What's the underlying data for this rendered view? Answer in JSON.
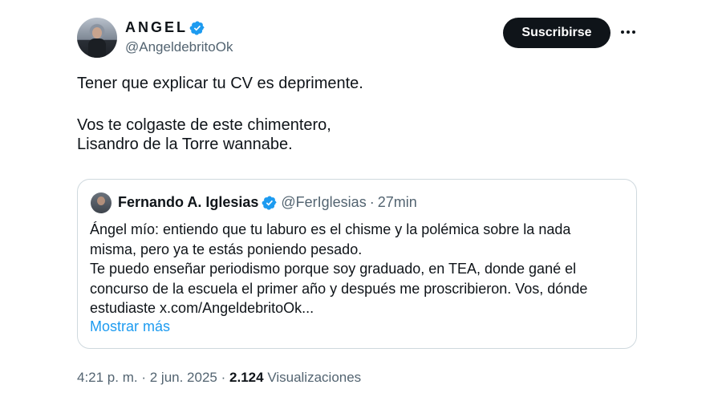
{
  "author": {
    "name": "ANGEL",
    "handle": "@AngeldebritoOk",
    "verified": true
  },
  "actions": {
    "subscribe_label": "Suscribirse",
    "more_icon": "more-horizontal-icon"
  },
  "tweet": {
    "line1": "Tener que explicar tu CV es deprimente.",
    "line2": "Vos te colgaste de este chimentero,",
    "line3": "Lisandro de la Torre wannabe."
  },
  "quote": {
    "name": "Fernando A. Iglesias",
    "handle": "@FerIglesias",
    "separator": "·",
    "time": "27min",
    "body": [
      "Ángel mío: entiendo que tu laburo es el chisme y la polémica sobre la nada",
      "misma, pero ya te estás poniendo pesado.",
      "Te puedo enseñar periodismo porque soy graduado, en TEA, donde gané el",
      "concurso de la escuela el primer año y después me proscribieron. Vos, dónde",
      "estudiaste x.com/AngeldebritoOk..."
    ],
    "show_more": "Mostrar más"
  },
  "meta": {
    "time": "4:21 p. m.",
    "sep1": "·",
    "date": "2 jun. 2025",
    "sep2": "·",
    "views_count": "2.124",
    "views_label": "Visualizaciones"
  },
  "colors": {
    "verified": "#1d9bf0",
    "link": "#1d9bf0",
    "text": "#0f1419",
    "secondary": "#536471",
    "border": "#cfd9de"
  }
}
